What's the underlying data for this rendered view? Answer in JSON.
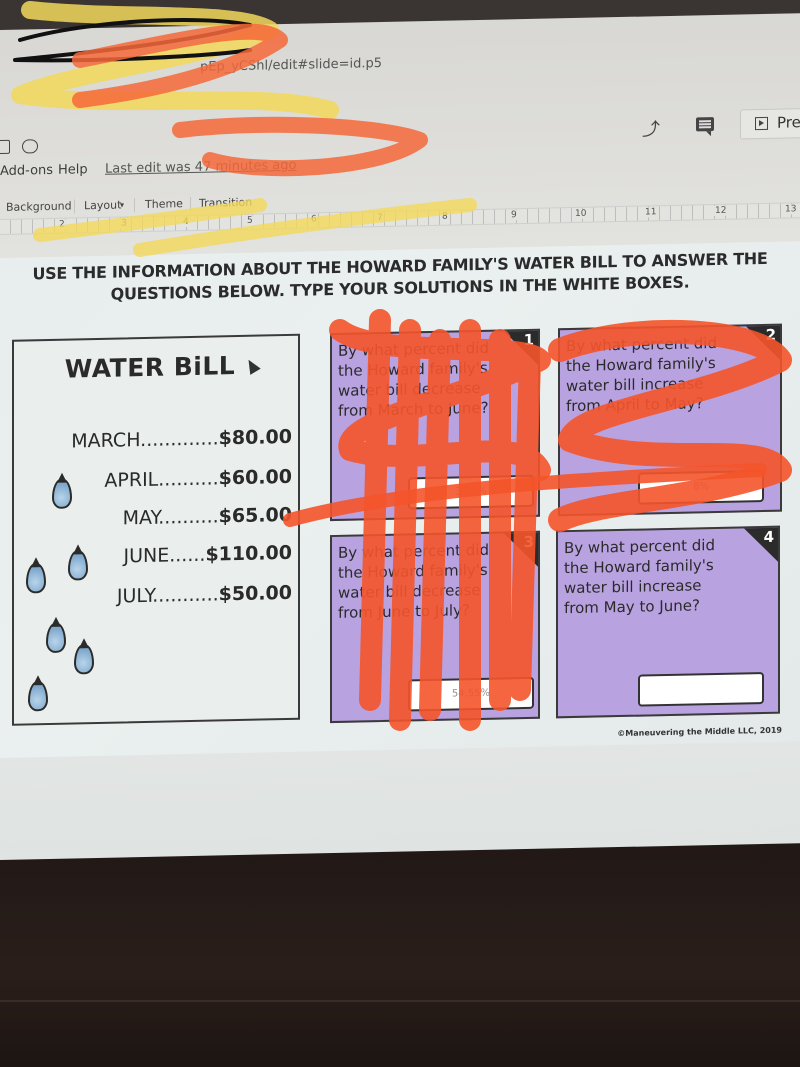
{
  "browser": {
    "url_fragment": "pEp_yCShl/edit#slide=id.p5"
  },
  "menu": {
    "items": [
      "Add-ons",
      "Help"
    ],
    "last_edit": "Last edit was 47 minutes ago"
  },
  "header_tools": {
    "activity_icon": "trending-up-icon",
    "comments_icon": "comment-icon",
    "present_label": "Pre"
  },
  "toolbar": {
    "items": [
      "Background",
      "Layout",
      "Theme",
      "Transition"
    ]
  },
  "ruler": {
    "marks": [
      "2",
      "3",
      "4",
      "5",
      "6",
      "7",
      "8",
      "9",
      "10",
      "11",
      "12",
      "13"
    ]
  },
  "slide": {
    "instructions_line1": "USE THE INFORMATION ABOUT THE HOWARD FAMILY'S WATER BILL TO ANSWER THE",
    "instructions_line2": "QUESTIONS BELOW. TYPE YOUR SOLUTIONS IN THE WHITE BOXES.",
    "bill": {
      "title": "WATER BiLL",
      "rows": [
        {
          "month": "MARCH",
          "dots": ".............",
          "amount": "$80.00"
        },
        {
          "month": "APRIL",
          "dots": "..........",
          "amount": "$60.00"
        },
        {
          "month": "MAY",
          "dots": "..........",
          "amount": "$65.00"
        },
        {
          "month": "JUNE",
          "dots": "......",
          "amount": "$110.00"
        },
        {
          "month": "JULY",
          "dots": "...........",
          "amount": "$50.00"
        }
      ]
    },
    "cards": [
      {
        "number": "1",
        "question": "By what percent did the Howard family's water bill decrease from March to June?",
        "answer": "37.5%"
      },
      {
        "number": "2",
        "question": "By what percent did the Howard family's water bill increase from April to May?",
        "answer": "8%"
      },
      {
        "number": "3",
        "question": "By what percent did the Howard family's water bill decrease from June to July?",
        "answer": "54.55%"
      },
      {
        "number": "4",
        "question": "By what percent did the Howard family's water bill increase from May to June?",
        "answer": ""
      }
    ],
    "copyright": "©Maneuvering the Middle LLC, 2019"
  }
}
